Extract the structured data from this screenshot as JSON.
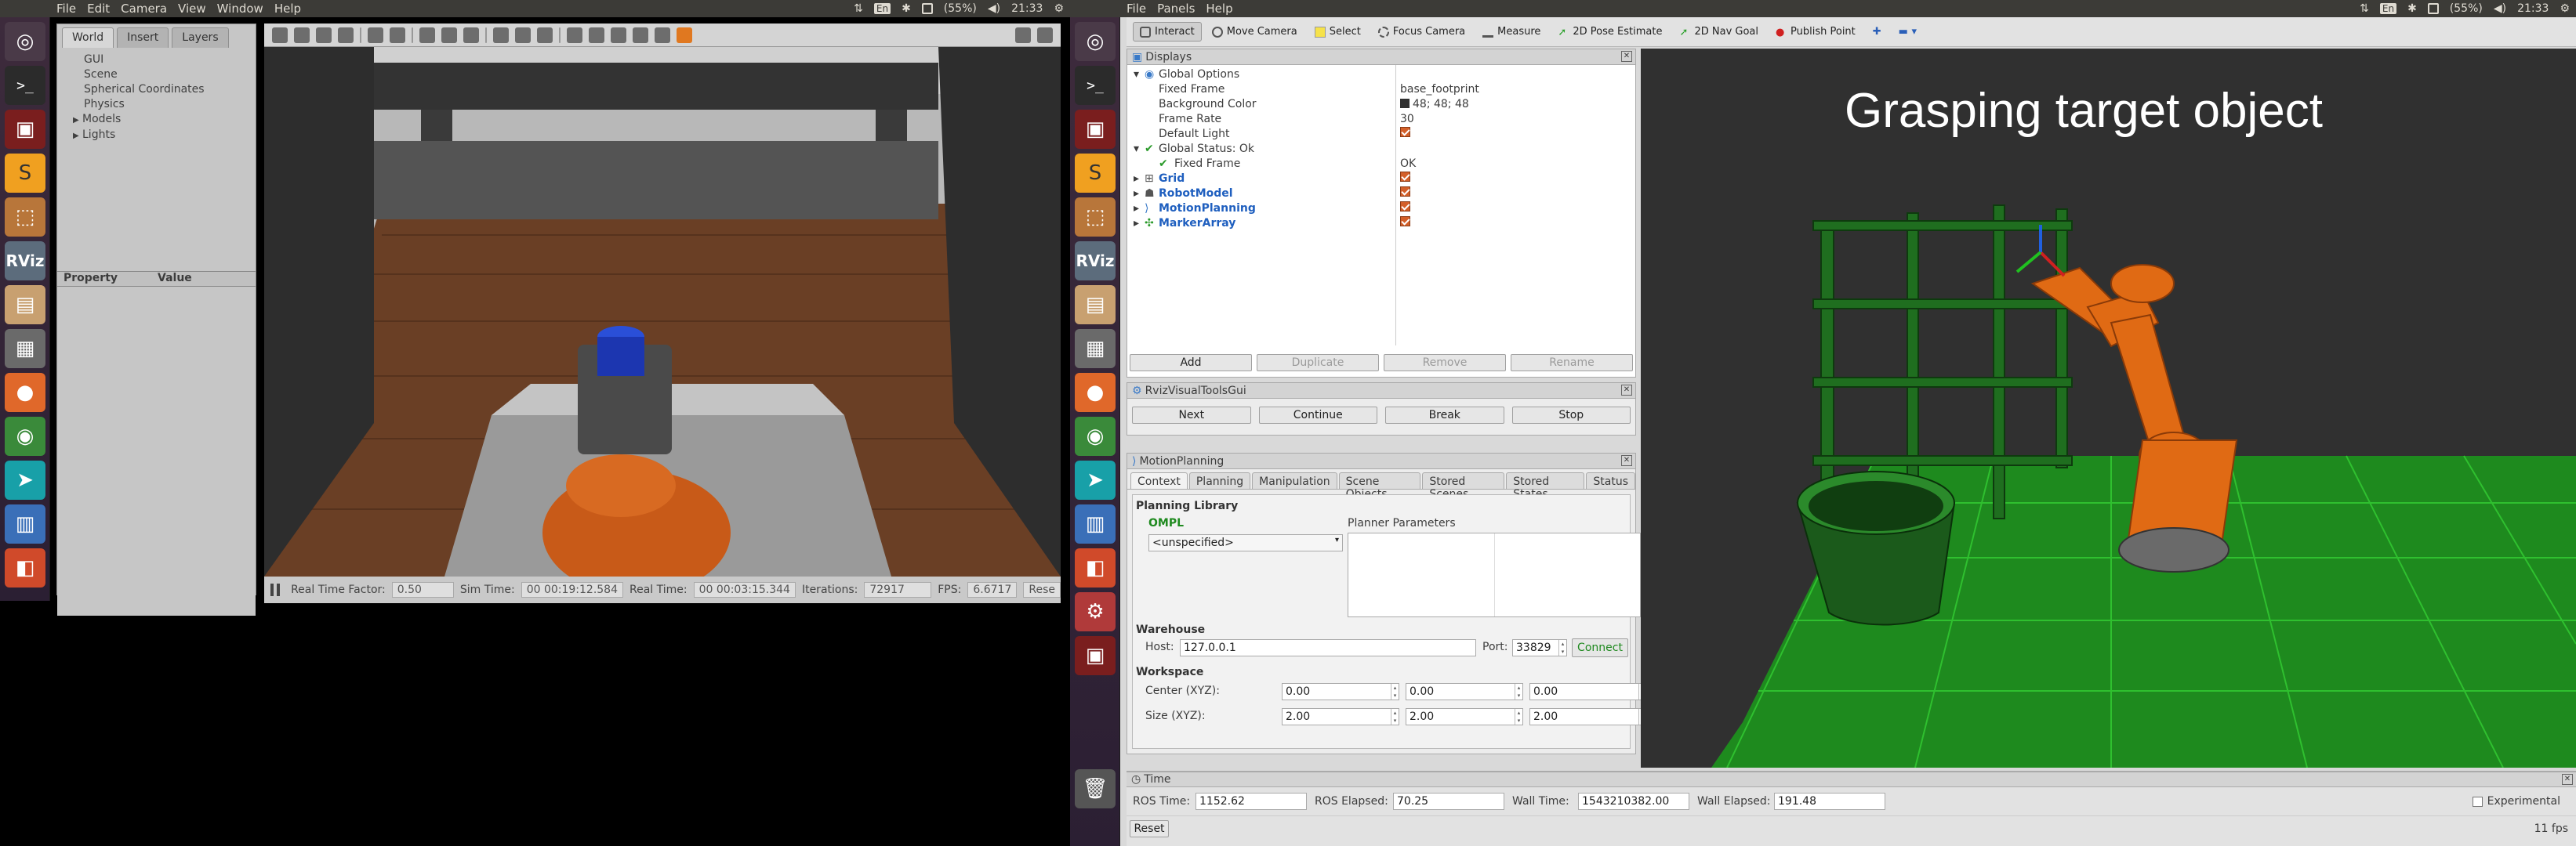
{
  "left": {
    "topbar": {
      "menus": [
        "File",
        "Edit",
        "Camera",
        "View",
        "Window",
        "Help"
      ],
      "battery": "(55%)",
      "clock": "21:33",
      "keyboard": "En"
    },
    "launcher_icons": [
      "ubuntu-dash-icon",
      "terminal-icon",
      "terminal-red-icon",
      "sublime-icon",
      "package-icon",
      "rviz-icon",
      "files-icon",
      "calculator-icon",
      "firefox-icon",
      "chrome-icon",
      "send-icon",
      "document-icon",
      "software-center-icon"
    ],
    "rviz_label": "RViz",
    "gazebo": {
      "tabs": [
        "World",
        "Insert",
        "Layers"
      ],
      "tree": [
        "GUI",
        "Scene",
        "Spherical Coordinates",
        "Physics",
        "Models",
        "Lights"
      ],
      "property_header": "Property",
      "value_header": "Value",
      "status": {
        "real_time_factor_label": "Real Time Factor:",
        "real_time_factor": "0.50",
        "sim_time_label": "Sim Time:",
        "sim_time": "00 00:19:12.584",
        "real_time_label": "Real Time:",
        "real_time": "00 00:03:15.344",
        "iterations_label": "Iterations:",
        "iterations": "72917",
        "fps_label": "FPS:",
        "fps": "6.6717",
        "reset": "Rese"
      }
    }
  },
  "right": {
    "topbar": {
      "menus": [
        "File",
        "Panels",
        "Help"
      ],
      "battery": "(55%)",
      "clock": "21:33",
      "keyboard": "En"
    },
    "toolbar": [
      "Interact",
      "Move Camera",
      "Select",
      "Focus Camera",
      "Measure",
      "2D Pose Estimate",
      "2D Nav Goal",
      "Publish Point"
    ],
    "displays": {
      "title": "Displays",
      "rows": {
        "global_options": "Global Options",
        "fixed_frame": "Fixed Frame",
        "fixed_frame_val": "base_footprint",
        "bg_color": "Background Color",
        "bg_color_val": "48; 48; 48",
        "frame_rate": "Frame Rate",
        "frame_rate_val": "30",
        "default_light": "Default Light",
        "global_status": "Global Status: Ok",
        "status_fixed_frame": "Fixed Frame",
        "status_fixed_frame_val": "OK",
        "grid": "Grid",
        "robot_model": "RobotModel",
        "motion_planning": "MotionPlanning",
        "marker_array": "MarkerArray"
      },
      "buttons": [
        "Add",
        "Duplicate",
        "Remove",
        "Rename"
      ]
    },
    "visual_tools": {
      "title": "RvizVisualToolsGui",
      "buttons": [
        "Next",
        "Continue",
        "Break",
        "Stop"
      ]
    },
    "motion_planning": {
      "title": "MotionPlanning",
      "tabs": [
        "Context",
        "Planning",
        "Manipulation",
        "Scene Objects",
        "Stored Scenes",
        "Stored States",
        "Status"
      ],
      "planning_library": "Planning Library",
      "ompl": "OMPL",
      "planner_select": "<unspecified>",
      "planner_params": "Planner Parameters",
      "warehouse": "Warehouse",
      "host_label": "Host:",
      "host": "127.0.0.1",
      "port_label": "Port:",
      "port": "33829",
      "connect": "Connect",
      "workspace": "Workspace",
      "center_label": "Center (XYZ):",
      "center": [
        "0.00",
        "0.00",
        "0.00"
      ],
      "size_label": "Size (XYZ):",
      "size": [
        "2.00",
        "2.00",
        "2.00"
      ]
    },
    "view3d": {
      "overlay_text": "Grasping  target  object"
    },
    "time": {
      "title": "Time",
      "ros_time_label": "ROS Time:",
      "ros_time": "1152.62",
      "ros_elapsed_label": "ROS Elapsed:",
      "ros_elapsed": "70.25",
      "wall_time_label": "Wall Time:",
      "wall_time": "1543210382.00",
      "wall_elapsed_label": "Wall Elapsed:",
      "wall_elapsed": "191.48",
      "experimental": "Experimental",
      "reset": "Reset",
      "fps": "11 fps"
    }
  }
}
